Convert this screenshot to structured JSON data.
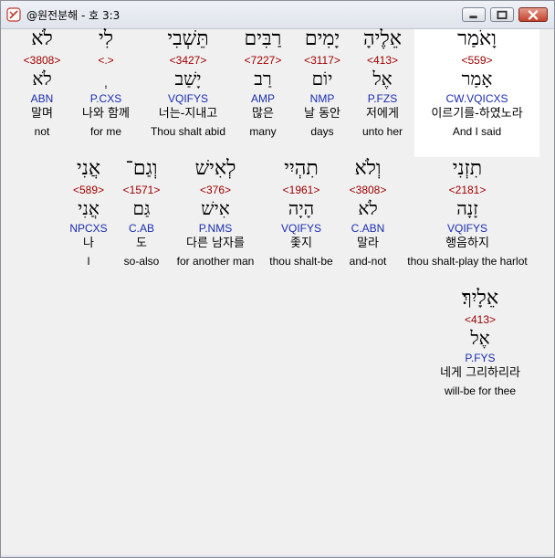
{
  "window": {
    "title": "@원전분해 - 호 3:3",
    "minimize_label": "minimize",
    "maximize_label": "maximize",
    "close_label": "close"
  },
  "rows": [
    [
      {
        "heb": "לֹא",
        "strong": "<3808>",
        "lemma": "לֹא",
        "parse": "ABN",
        "korean": "말며",
        "english": "not"
      },
      {
        "heb": "לִי",
        "strong": "<.>",
        "lemma": "ְ",
        "parse": "P.CXS",
        "korean": "나와 함께",
        "english": "for me"
      },
      {
        "heb": "תֵּשְׁבִי",
        "strong": "<3427>",
        "lemma": "יָשַׁב",
        "parse": "VQIFYS",
        "korean": "너는-지내고",
        "english": "Thou shalt abid"
      },
      {
        "heb": "רַבִּים",
        "strong": "<7227>",
        "lemma": "רַב",
        "parse": "AMP",
        "korean": "많은",
        "english": "many"
      },
      {
        "heb": "יָמִים",
        "strong": "<3117>",
        "lemma": "יוֹם",
        "parse": "NMP",
        "korean": "날 동안",
        "english": "days"
      },
      {
        "heb": "אֵלֶיהָ",
        "strong": "<413>",
        "lemma": "אֶל",
        "parse": "P.FZS",
        "korean": "저에게",
        "english": "unto her"
      },
      {
        "heb": "וָאֹמַר",
        "strong": "<559>",
        "lemma": "אָמַר",
        "parse": "CW.VQICXS",
        "korean": "이르기를-하였노라",
        "english": "And I said"
      }
    ],
    [
      {
        "heb": "אֲנִי",
        "strong": "<589>",
        "lemma": "אֲנִי",
        "parse": "NPCXS",
        "korean": "나",
        "english": "I"
      },
      {
        "heb": "וְגַם־",
        "strong": "<1571>",
        "lemma": "גַּם",
        "parse": "C.AB",
        "korean": "도",
        "english": "so-also"
      },
      {
        "heb": "לְאִישׁ",
        "strong": "<376>",
        "lemma": "אִישׁ",
        "parse": "P.NMS",
        "korean": "다른 남자를",
        "english": "for another man"
      },
      {
        "heb": "תִהְיִי",
        "strong": "<1961>",
        "lemma": "הָיָה",
        "parse": "VQIFYS",
        "korean": "좇지",
        "english": "thou shalt-be"
      },
      {
        "heb": "וְלֹא",
        "strong": "<3808>",
        "lemma": "לֹא",
        "parse": "C.ABN",
        "korean": "말라",
        "english": "and-not"
      },
      {
        "heb": "תִזְנִי",
        "strong": "<2181>",
        "lemma": "זָנָה",
        "parse": "VQIFYS",
        "korean": "행음하지",
        "english": "thou shalt-play the harlot"
      }
    ],
    [
      {
        "heb": "אֵלָיִךְ׃",
        "strong": "<413>",
        "lemma": "אֶל",
        "parse": "P.FYS",
        "korean": "네게 그리하리라",
        "english": "will-be for thee"
      }
    ]
  ]
}
